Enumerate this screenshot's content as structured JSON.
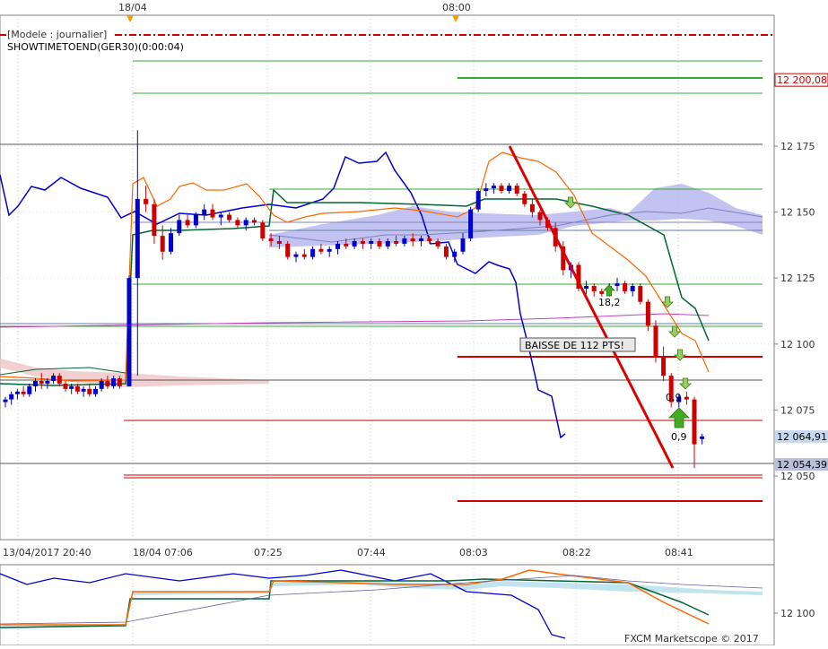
{
  "header": {
    "title": "[Modele : journalier]",
    "indicator": "SHOWTIMETOEND(GER30)(0:00:04)",
    "top_markers": [
      "18/04",
      "08:00"
    ]
  },
  "price_axis": {
    "ticks": [
      "12 175",
      "12 150",
      "12 125",
      "12 100",
      "12 075",
      "12 050"
    ],
    "labels": [
      {
        "text": "12 200,08",
        "value": 12200.08,
        "bg": "#ffffff",
        "fg": "#cc0000"
      },
      {
        "text": "12 064,91",
        "value": 12064.91,
        "bg": "#c8d8f0",
        "fg": "#000000"
      },
      {
        "text": "12 054,39",
        "value": 12054.39,
        "bg": "#b8c0d8",
        "fg": "#000000"
      }
    ]
  },
  "time_axis": {
    "ticks": [
      "13/04/2017 20:40",
      "18/04 07:06",
      "07:25",
      "07:44",
      "08:03",
      "08:22",
      "08:41"
    ]
  },
  "annotations": {
    "baisse": "BAISSE DE 112 PTS!",
    "value_1": "18,2",
    "value_2": "0,9",
    "value_3": "0,9"
  },
  "lower_panel": {
    "tick": "12 100"
  },
  "footer": {
    "copyright": "FXCM Marketscope © 2017"
  },
  "colors": {
    "bull": "#0000cc",
    "bear": "#cc0000",
    "chikou": "#0000cc",
    "kijun": "#006633",
    "tenkan": "#ff6600",
    "cloud_bull": "#b8b8f0",
    "cloud_bear": "#f0c8c8",
    "trendline": "#dd0000",
    "support": "#33aa33",
    "arrow_green": "#44aa22"
  },
  "chart_data": {
    "type": "candlestick",
    "title": "",
    "xlabel": "",
    "ylabel": "",
    "ylim": [
      12030,
      12205
    ],
    "x": [
      "13/04/2017 20:40",
      "18/04 07:06",
      "07:25",
      "07:44",
      "08:03",
      "08:22",
      "08:41"
    ],
    "candles_ohlc": [
      [
        12078,
        12080,
        12076,
        12079
      ],
      [
        12079,
        12082,
        12077,
        12081
      ],
      [
        12081,
        12083,
        12079,
        12082
      ],
      [
        12082,
        12084,
        12080,
        12081
      ],
      [
        12081,
        12085,
        12080,
        12084
      ],
      [
        12084,
        12087,
        12082,
        12086
      ],
      [
        12086,
        12089,
        12083,
        12085
      ],
      [
        12085,
        12087,
        12083,
        12086
      ],
      [
        12086,
        12089,
        12085,
        12088
      ],
      [
        12088,
        12089,
        12084,
        12085
      ],
      [
        12085,
        12086,
        12082,
        12083
      ],
      [
        12083,
        12085,
        12081,
        12084
      ],
      [
        12084,
        12085,
        12081,
        12082
      ],
      [
        12082,
        12084,
        12080,
        12083
      ],
      [
        12083,
        12085,
        12080,
        12081
      ],
      [
        12081,
        12084,
        12080,
        12083
      ],
      [
        12083,
        12087,
        12082,
        12086
      ],
      [
        12086,
        12088,
        12083,
        12084
      ],
      [
        12084,
        12088,
        12083,
        12087
      ],
      [
        12087,
        12088,
        12083,
        12084
      ],
      [
        12084,
        12126,
        12084,
        12125
      ],
      [
        12125,
        12181,
        12088,
        12155
      ],
      [
        12155,
        12160,
        12150,
        12153
      ],
      [
        12153,
        12155,
        12138,
        12141
      ],
      [
        12141,
        12145,
        12132,
        12135
      ],
      [
        12135,
        12144,
        12134,
        12142
      ],
      [
        12142,
        12149,
        12141,
        12147
      ],
      [
        12147,
        12149,
        12144,
        12145
      ],
      [
        12145,
        12150,
        12144,
        12149
      ],
      [
        12149,
        12153,
        12147,
        12151
      ],
      [
        12151,
        12153,
        12147,
        12148
      ],
      [
        12148,
        12150,
        12145,
        12149
      ],
      [
        12149,
        12150,
        12146,
        12147
      ],
      [
        12147,
        12148,
        12144,
        12145
      ],
      [
        12145,
        12148,
        12143,
        12147
      ],
      [
        12147,
        12148,
        12145,
        12146
      ],
      [
        12146,
        12147,
        12139,
        12140
      ],
      [
        12140,
        12142,
        12137,
        12139
      ],
      [
        12139,
        12141,
        12136,
        12138
      ],
      [
        12138,
        12139,
        12132,
        12133
      ],
      [
        12133,
        12135,
        12131,
        12134
      ],
      [
        12134,
        12136,
        12132,
        12133
      ],
      [
        12133,
        12137,
        12132,
        12136
      ],
      [
        12136,
        12138,
        12134,
        12135
      ],
      [
        12135,
        12137,
        12133,
        12136
      ],
      [
        12136,
        12139,
        12134,
        12138
      ],
      [
        12138,
        12140,
        12136,
        12137
      ],
      [
        12137,
        12140,
        12136,
        12139
      ],
      [
        12139,
        12140,
        12136,
        12138
      ],
      [
        12138,
        12140,
        12136,
        12139
      ],
      [
        12139,
        12140,
        12136,
        12137
      ],
      [
        12137,
        12140,
        12136,
        12139
      ],
      [
        12139,
        12141,
        12137,
        12138
      ],
      [
        12138,
        12141,
        12137,
        12140
      ],
      [
        12140,
        12142,
        12137,
        12139
      ],
      [
        12139,
        12141,
        12137,
        12140
      ],
      [
        12140,
        12141,
        12138,
        12139
      ],
      [
        12139,
        12140,
        12136,
        12137
      ],
      [
        12137,
        12138,
        12132,
        12133
      ],
      [
        12133,
        12136,
        12131,
        12135
      ],
      [
        12135,
        12142,
        12134,
        12140
      ],
      [
        12140,
        12152,
        12139,
        12151
      ],
      [
        12151,
        12159,
        12150,
        12158
      ],
      [
        12158,
        12161,
        12156,
        12159
      ],
      [
        12159,
        12161,
        12157,
        12160
      ],
      [
        12160,
        12161,
        12157,
        12158
      ],
      [
        12158,
        12161,
        12157,
        12160
      ],
      [
        12160,
        12161,
        12156,
        12157
      ],
      [
        12157,
        12158,
        12152,
        12153
      ],
      [
        12153,
        12155,
        12148,
        12150
      ],
      [
        12150,
        12151,
        12145,
        12147
      ],
      [
        12147,
        12148,
        12143,
        12144
      ],
      [
        12144,
        12146,
        12135,
        12137
      ],
      [
        12137,
        12139,
        12126,
        12128
      ],
      [
        12128,
        12131,
        12125,
        12130
      ],
      [
        12130,
        12131,
        12120,
        12121
      ],
      [
        12121,
        12124,
        12119,
        12122
      ],
      [
        12122,
        12123,
        12118,
        12120
      ],
      [
        12120,
        12121,
        12118,
        12119
      ],
      [
        12119,
        12123,
        12118,
        12122
      ],
      [
        12122,
        12125,
        12120,
        12123
      ],
      [
        12123,
        12124,
        12119,
        12120
      ],
      [
        12120,
        12123,
        12118,
        12122
      ],
      [
        12122,
        12123,
        12115,
        12116
      ],
      [
        12116,
        12117,
        12105,
        12107
      ],
      [
        12107,
        12109,
        12093,
        12095
      ],
      [
        12095,
        12099,
        12086,
        12088
      ],
      [
        12088,
        12089,
        12076,
        12078
      ],
      [
        12078,
        12081,
        12076,
        12080
      ],
      [
        12080,
        12082,
        12077,
        12079
      ],
      [
        12079,
        12080,
        12053,
        12062
      ],
      [
        12064,
        12066,
        12062,
        12065
      ]
    ],
    "levels": {
      "resistance_dashdot": 12200.08,
      "bid": 12064.91,
      "ask": 12054.39
    },
    "annotation_values": [
      "18,2",
      "0,9",
      "0,9"
    ]
  }
}
